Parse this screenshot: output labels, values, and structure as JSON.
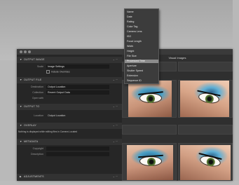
{
  "browser": {
    "title": "Visual Images"
  },
  "sort_menu": {
    "items": [
      "Name",
      "Date",
      "Rating",
      "Color Tag",
      "Camera Lens",
      "ISO",
      "Focal Length",
      "Width",
      "Height",
      "File Size",
      "Processed Time",
      "Aperture",
      "Shutter Speed",
      "Extension",
      "Sequence ID"
    ],
    "selected": "Processed Time"
  },
  "inspector": {
    "sections": [
      {
        "label": "Output Image"
      },
      {
        "label": "Output File"
      },
      {
        "label": "Output To"
      },
      {
        "label": "Overlay"
      },
      {
        "label": "Metadata"
      },
      {
        "label": "Adjustments"
      }
    ],
    "output_image": {
      "scale_key": "Scale",
      "scale_value": "Image Settings",
      "include_label": "Include Overrides"
    },
    "output_file": {
      "location_key": "Destination",
      "location_value": "Output Location",
      "collection_key": "Collection",
      "collection_value": "Recent Output Data",
      "open_key": "Open with"
    },
    "output_to": {
      "naming_key": "Location",
      "naming_value": "Output Location"
    },
    "message": "Nothing is displayed while editing files in Camera Located",
    "metadata": {
      "copyright_key": "Copyright",
      "description_key": "Description"
    }
  },
  "colors": {
    "menu_selected": "#8c8c8c",
    "panel_bg": "#262626",
    "browser_bg": "#2f2f2f"
  }
}
